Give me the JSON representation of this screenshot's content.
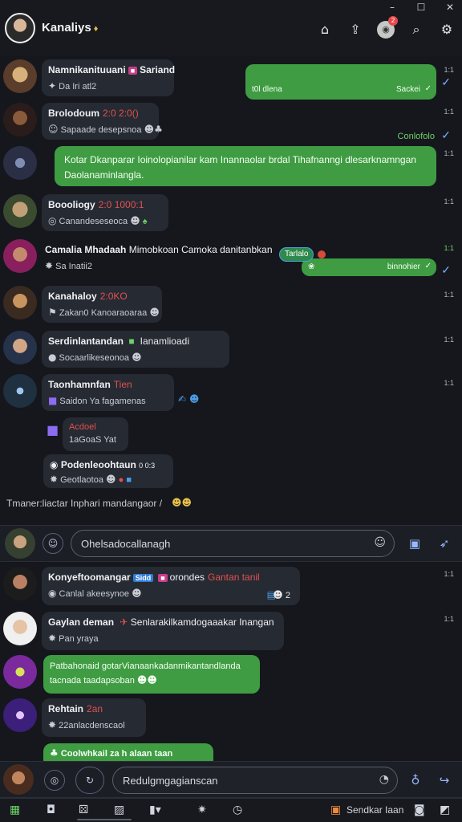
{
  "window": {
    "controls": [
      "–",
      "☐",
      "✕"
    ]
  },
  "header": {
    "title": "Kanaliys",
    "title_badge": "♦",
    "tools": [
      "camera-icon",
      "share-icon",
      "avatar-icon",
      "search-icon",
      "settings-icon"
    ],
    "notification_count": "2"
  },
  "chats": [
    {
      "name": "Namnikanituuani",
      "tag": "Sariand",
      "sub": "Da Iri atl2",
      "time": "1:1"
    },
    {
      "name": "Brolodoum",
      "tag": "2:0  2:0()",
      "sub": "Sapaade desepsnoa",
      "time": "1:1"
    },
    {
      "name": "Boooliogy",
      "tag": "2:0  1000:1",
      "sub": "Canandeseseoca",
      "time": "1:1"
    },
    {
      "name": "Camalia Mhadaah",
      "tag": "Mimobkoan Camoka danitanbkan",
      "sub": "Sa Inatii2",
      "time": "1:1"
    },
    {
      "name": "Kanahaloy",
      "tag": "2:0KO",
      "sub": "Zakan0 Kanoaraoaraa",
      "time": "1:1"
    },
    {
      "name": "Serdinlantandan",
      "tag": "Ianamlioadi",
      "sub": "Socaarlikeseonoa",
      "time": "1:1"
    },
    {
      "name": "Taonhamnfan",
      "tag": "Tien",
      "sub": "Saidon Ya fagamenas",
      "time": "1:1"
    },
    {
      "name": "Acdoel",
      "tag": "",
      "sub": "1aGoaS Yat",
      "time": ""
    },
    {
      "name": "Podenleoohtaun",
      "tag": "0 0:3",
      "sub": "Geotlaotoa",
      "time": ""
    }
  ],
  "outgoing": [
    {
      "left": "t0l dlena",
      "right": "Sackei",
      "time": "1:1"
    },
    {
      "text": "Conlofolo",
      "time": "1:1"
    },
    {
      "text": "Kotar Dkanparar Ioinolopianilar kam Inannaolar brdal Tihafnanngi dlesarknamngan Daolanaminlangla.",
      "time": "1:1"
    },
    {
      "top": "Tarlalo",
      "bottom": "binnohier",
      "time": "1:1"
    }
  ],
  "typing_line": "Tmaner:liactar Inphari mandangaor /",
  "composer_top": {
    "placeholder": "Ohelsadocallanagh"
  },
  "lower_chats": [
    {
      "name": "Konyeftoomangar",
      "tag1": "Sidd",
      "tag2": "orondes",
      "tag3": "Gantan tanil",
      "sub": "Canlal akeesynoe",
      "count": "2",
      "time": "1:1"
    },
    {
      "name": "Gaylan deman",
      "tag": "Senlarakilkamdogaaakar Inangan",
      "sub": "Pan yraya",
      "time": "1:1"
    },
    {
      "green_text": "Patbahonaid gotarVianaankadanmikantandlanda tacnada taadapsoban"
    },
    {
      "name": "Rehtain",
      "tag": "2an",
      "sub": "22anlacdenscaol"
    },
    {
      "green_text": "Coolwhkail za h alaan taan"
    }
  ],
  "composer_bottom": {
    "placeholder": "Redulgmgagianscan"
  },
  "bottom_bar": {
    "label": "Sendkar Iaan"
  }
}
